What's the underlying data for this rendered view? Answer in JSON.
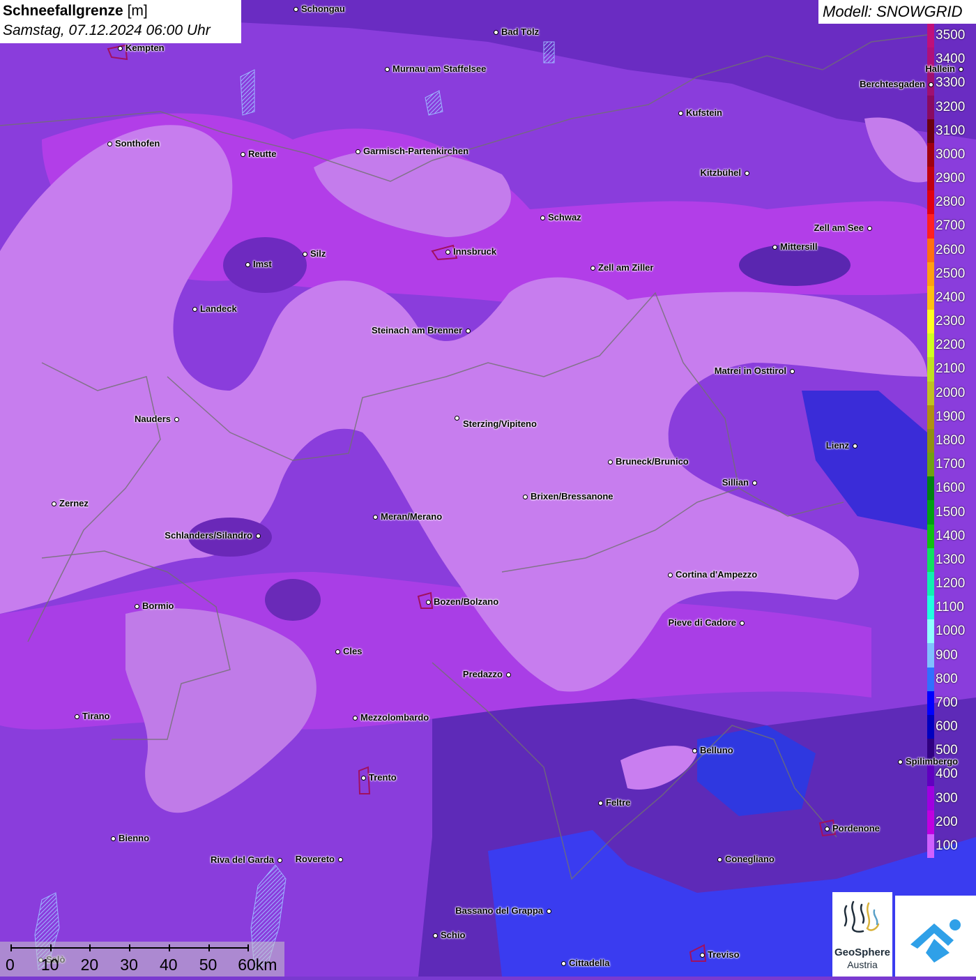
{
  "title": {
    "bold": "Schneefallgrenze",
    "unit": " [m]",
    "date": "Samstag, 07.12.2024 06:00 Uhr"
  },
  "model": "Modell: SNOWGRID",
  "legend": {
    "labels": [
      "3500",
      "3400",
      "3300",
      "3200",
      "3100",
      "3000",
      "2900",
      "2800",
      "2700",
      "2600",
      "2500",
      "2400",
      "2300",
      "2200",
      "2100",
      "2000",
      "1900",
      "1800",
      "1700",
      "1600",
      "1500",
      "1400",
      "1300",
      "1200",
      "1100",
      "1000",
      "900",
      "800",
      "700",
      "600",
      "500",
      "400",
      "300",
      "200",
      "100"
    ],
    "colors": [
      "#c0107a",
      "#b0107a",
      "#a01070",
      "#8a0a60",
      "#6a0010",
      "#a00010",
      "#c00010",
      "#e00010",
      "#ff2020",
      "#ff7010",
      "#ffa010",
      "#ffc010",
      "#ffff20",
      "#d0ff20",
      "#c0e020",
      "#c0c020",
      "#b09010",
      "#909010",
      "#70a010",
      "#008010",
      "#00a010",
      "#10c010",
      "#10e060",
      "#10f0b0",
      "#20ffe0",
      "#90ffff",
      "#80c0ff",
      "#3070ff",
      "#0000ff",
      "#0000c0",
      "#300080",
      "#6000c0",
      "#a000e0",
      "#c000e0",
      "#d060ff"
    ]
  },
  "cities": [
    {
      "name": "Schongau"
    },
    {
      "name": "Bad Tölz"
    },
    {
      "name": "Kempten"
    },
    {
      "name": "Murnau am Staffelsee"
    },
    {
      "name": "Hallein"
    },
    {
      "name": "Berchtesgaden"
    },
    {
      "name": "Kufstein"
    },
    {
      "name": "Sonthofen"
    },
    {
      "name": "Reutte"
    },
    {
      "name": "Garmisch-Partenkirchen"
    },
    {
      "name": "Kitzbühel"
    },
    {
      "name": "Schwaz"
    },
    {
      "name": "Zell am See"
    },
    {
      "name": "Mittersill"
    },
    {
      "name": "Innsbruck"
    },
    {
      "name": "Silz"
    },
    {
      "name": "Imst"
    },
    {
      "name": "Zell am Ziller"
    },
    {
      "name": "Landeck"
    },
    {
      "name": "Steinach am Brenner"
    },
    {
      "name": "Matrei in Osttirol"
    },
    {
      "name": "Nauders"
    },
    {
      "name": "Sterzing/Vipiteno"
    },
    {
      "name": "Lienz"
    },
    {
      "name": "Bruneck/Brunico"
    },
    {
      "name": "Sillian"
    },
    {
      "name": "Zernez"
    },
    {
      "name": "Brixen/Bressanone"
    },
    {
      "name": "Meran/Merano"
    },
    {
      "name": "Schlanders/Silandro"
    },
    {
      "name": "Cortina d'Ampezzo"
    },
    {
      "name": "Bozen/Bolzano"
    },
    {
      "name": "Bormio"
    },
    {
      "name": "Pieve di Cadore"
    },
    {
      "name": "Cles"
    },
    {
      "name": "Predazzo"
    },
    {
      "name": "Tirano"
    },
    {
      "name": "Mezzolombardo"
    },
    {
      "name": "Belluno"
    },
    {
      "name": "Spilimbergo"
    },
    {
      "name": "Trento"
    },
    {
      "name": "Feltre"
    },
    {
      "name": "Pordenone"
    },
    {
      "name": "Bienno"
    },
    {
      "name": "Riva del Garda"
    },
    {
      "name": "Rovereto"
    },
    {
      "name": "Conegliano"
    },
    {
      "name": "Bassano del Grappa"
    },
    {
      "name": "Schio"
    },
    {
      "name": "Salò"
    },
    {
      "name": "Treviso"
    },
    {
      "name": "Cittadella"
    }
  ],
  "scale": {
    "labels": [
      "0",
      "10",
      "20",
      "30",
      "40",
      "50",
      "60km"
    ]
  },
  "logo": {
    "name": "GeoSphere",
    "sub": "Austria"
  }
}
